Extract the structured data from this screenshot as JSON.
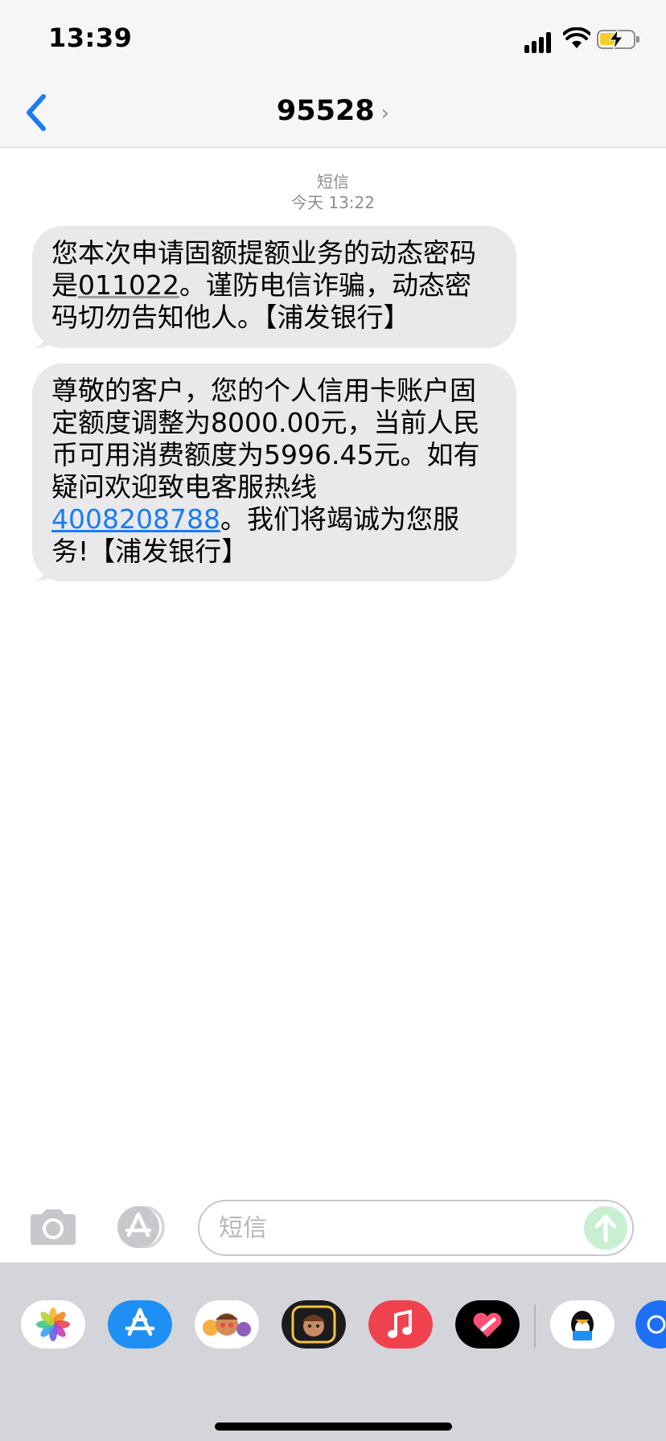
{
  "status_bar": {
    "time": "13:39",
    "icons": [
      "cellular-signal-icon",
      "wifi-icon",
      "battery-charging-icon"
    ]
  },
  "nav": {
    "back_icon": "chevron-left-icon",
    "title": "95528",
    "title_chevron": "›",
    "accent_color": "#1a7cf5"
  },
  "conversation": {
    "service": "短信",
    "date_time": "今天 13:22",
    "messages": [
      {
        "before": "您本次申请固额提额业务的动态密码是",
        "code": "011022",
        "after": "。谨防电信诈骗，动态密码切勿告知他人。【浦发银行】"
      },
      {
        "before": "尊敬的客户，您的个人信用卡账户固定额度调整为8000.00元，当前人民币可用消费额度为5996.45元。如有疑问欢迎致电客服热线",
        "phone": "4008208788",
        "after": "。我们将竭诚为您服务!【浦发银行】"
      }
    ]
  },
  "input_bar": {
    "placeholder": "短信",
    "value": "",
    "icons": [
      "camera-icon",
      "app-store-icon",
      "send-arrow-icon"
    ]
  },
  "app_drawer": {
    "apps": [
      "photos-icon",
      "app-store-icon",
      "memoji-stickers-icon",
      "memoji-icon",
      "music-icon",
      "digital-touch-icon",
      "qq-icon",
      "partial-app-icon"
    ]
  }
}
